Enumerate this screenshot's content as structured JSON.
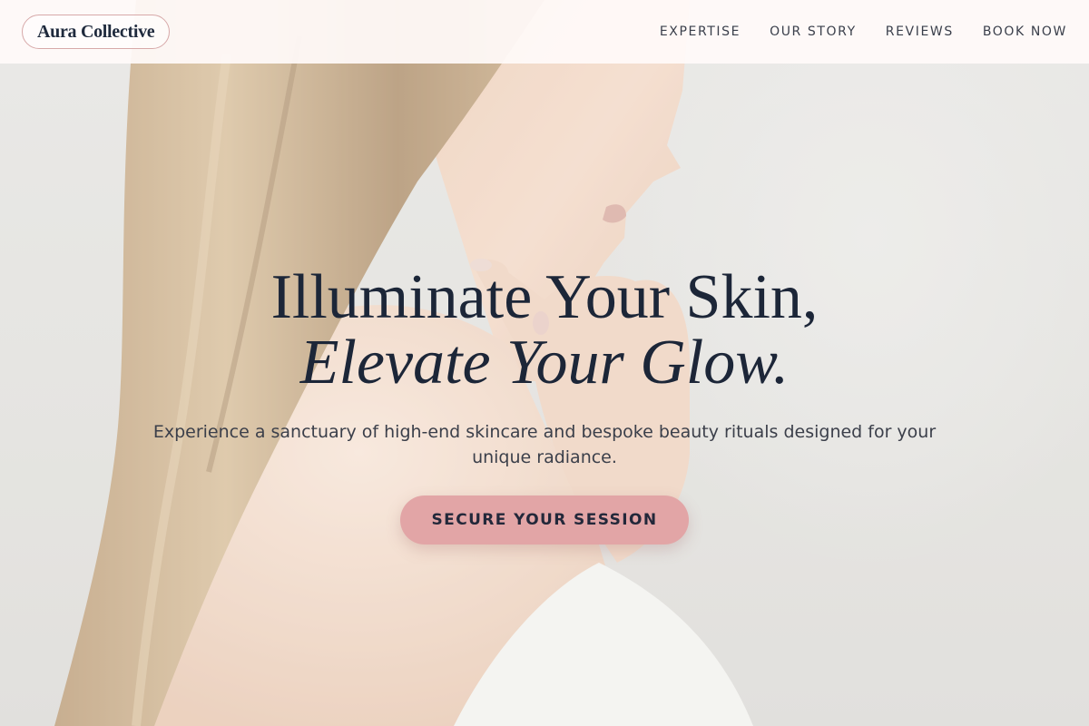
{
  "brand": {
    "logo_text": "Aura Collective"
  },
  "nav": {
    "items": [
      {
        "label": "EXPERTISE"
      },
      {
        "label": "OUR STORY"
      },
      {
        "label": "REVIEWS"
      },
      {
        "label": "BOOK NOW"
      }
    ]
  },
  "hero": {
    "title_line1": "Illuminate Your Skin,",
    "title_line2": "Elevate Your Glow.",
    "subtitle": "Experience a sanctuary of high-end skincare and bespoke beauty rituals designed for your unique radiance.",
    "cta_label": "SECURE YOUR SESSION"
  },
  "colors": {
    "accent": "#e2a5a6",
    "text_dark": "#1c2638",
    "nav_bg": "#fffaf9"
  }
}
